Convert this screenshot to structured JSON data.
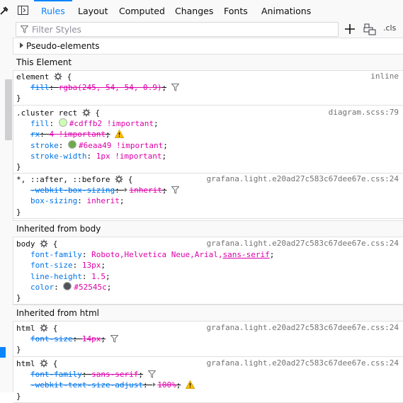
{
  "colors": {
    "accent": "#0a84ff",
    "property": "#0074e8",
    "value": "#dd00a9",
    "warning": "#ffbf00"
  },
  "toolbar": {
    "tabs": [
      {
        "label": "Rules",
        "active": true
      },
      {
        "label": "Layout",
        "active": false
      },
      {
        "label": "Computed",
        "active": false
      },
      {
        "label": "Changes",
        "active": false
      },
      {
        "label": "Fonts",
        "active": false
      },
      {
        "label": "Animations",
        "active": false
      }
    ],
    "filter_placeholder": "Filter Styles",
    "filter_value": "",
    "cls_label": ".cls",
    "icons": [
      "element-picker-icon",
      "sidebar-toggle-icon",
      "filter-icon",
      "add-rule-icon",
      "print-simulation-icon"
    ]
  },
  "pseudo_elements_label": "Pseudo-elements",
  "sections": {
    "this_element": "This Element",
    "inherited_body": "Inherited from body",
    "inherited_html": "Inherited from html"
  },
  "rules": [
    {
      "selector": "element",
      "source": "inline",
      "decls": [
        {
          "prop": "fill",
          "value": "rgba(245, 54, 54, 0.9)",
          "overridden": true,
          "filter_icon": true
        }
      ]
    },
    {
      "selector": ".cluster rect",
      "source": "diagram.scss:79",
      "decls": [
        {
          "prop": "fill",
          "value": "#cdffb2 !important",
          "swatch": "#cdffb2"
        },
        {
          "prop": "rx",
          "value": "4 !important",
          "overridden": true,
          "warning": true
        },
        {
          "prop": "stroke",
          "value": "#6eaa49 !important",
          "swatch": "#6eaa49"
        },
        {
          "prop": "stroke-width",
          "value": "1px !important"
        }
      ]
    },
    {
      "selector": "*, ::after, ::before",
      "source": "grafana.light.e20ad27c583c67dee67e.css:24",
      "decls": [
        {
          "prop": "-webkit-box-sizing",
          "value": "inherit",
          "overridden": true,
          "expander": true,
          "filter_icon": true
        },
        {
          "prop": "box-sizing",
          "value": "inherit"
        }
      ]
    },
    {
      "selector": "body",
      "source": "grafana.light.e20ad27c583c67dee67e.css:24",
      "decls": [
        {
          "prop": "font-family",
          "value": "Roboto,Helvetica Neue,Arial,",
          "value_tail": "sans-serif"
        },
        {
          "prop": "font-size",
          "value": "13px"
        },
        {
          "prop": "line-height",
          "value": "1.5"
        },
        {
          "prop": "color",
          "value": "#52545c",
          "swatch": "#52545c"
        }
      ]
    },
    {
      "selector": "html",
      "source": "grafana.light.e20ad27c583c67dee67e.css:24",
      "decls": [
        {
          "prop": "font-size",
          "value": "14px",
          "overridden": true,
          "filter_icon": true
        }
      ]
    },
    {
      "selector": "html",
      "source": "grafana.light.e20ad27c583c67dee67e.css:24",
      "decls": [
        {
          "prop": "font-family",
          "value": "sans-serif",
          "overridden": true,
          "filter_icon": true
        },
        {
          "prop": "-webkit-text-size-adjust",
          "value": "100%",
          "overridden": true,
          "expander": true,
          "warning": true
        }
      ]
    }
  ]
}
